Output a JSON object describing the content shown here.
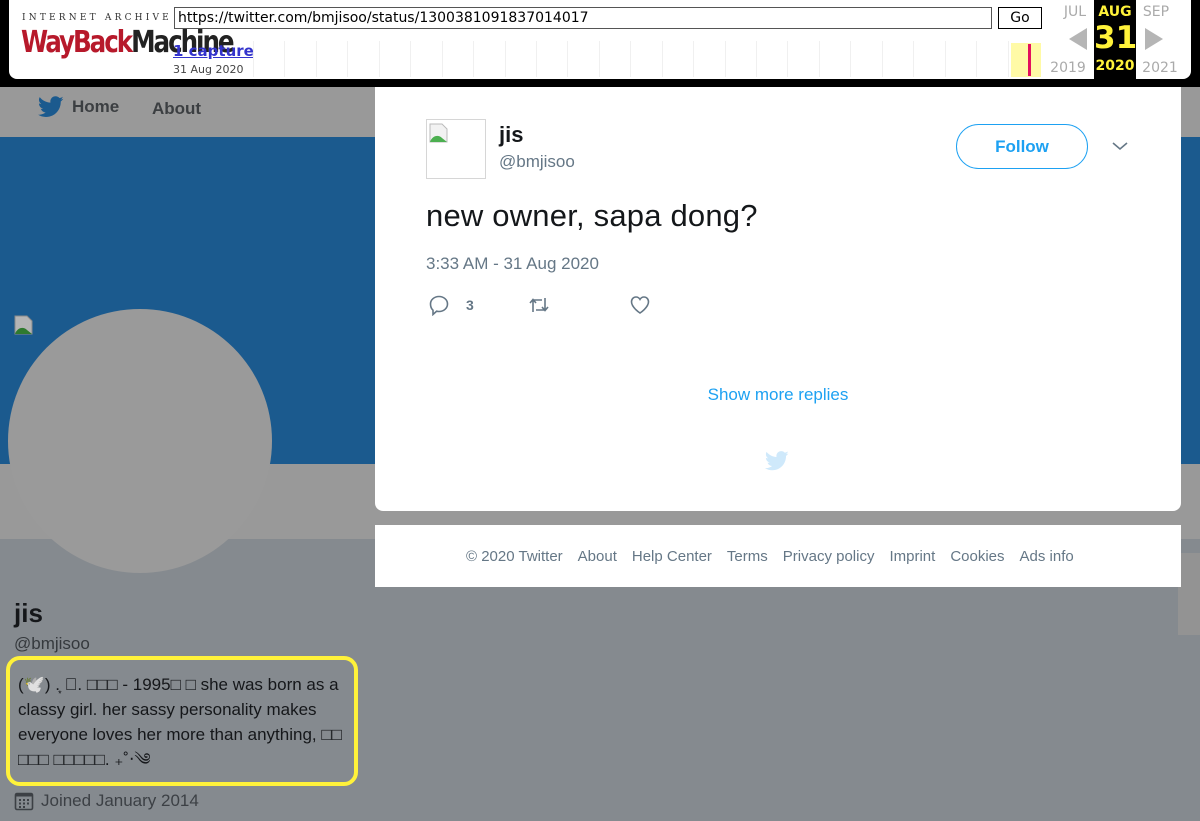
{
  "wayback": {
    "logo_top": "INTERNET ARCHIVE",
    "logo_part1": "WayBack",
    "logo_part2": "Machine",
    "url": "https://twitter.com/bmjisoo/status/1300381091837014017",
    "go_label": "Go",
    "captures_label": "1 capture",
    "captures_date": "31 Aug 2020",
    "prev_month": "JUL",
    "current_month": "AUG",
    "next_month": "SEP",
    "current_day": "31",
    "prev_year": "2019",
    "current_year": "2020",
    "next_year": "2021"
  },
  "nav": {
    "home_label": "Home",
    "about_label": "About"
  },
  "profile": {
    "name": "jis",
    "handle": "@bmjisoo",
    "bio": "(🕊️) .͙ ⃟. □□□ - 1995□ □ she was born as a classy girl. her sassy personality makes everyone loves her more than anything, □□ □□□ □□□□□. ₊˚‧༄",
    "joined": "Joined January 2014"
  },
  "tweet": {
    "author_name": "jis",
    "author_handle": "@bmjisoo",
    "follow_label": "Follow",
    "text": "new owner, sapa dong?",
    "timestamp": "3:33 AM - 31 Aug 2020",
    "reply_count": "3",
    "show_more_label": "Show more replies"
  },
  "footer": {
    "copyright": "© 2020 Twitter",
    "links": [
      "About",
      "Help Center",
      "Terms",
      "Privacy policy",
      "Imprint",
      "Cookies",
      "Ads info"
    ]
  },
  "colors": {
    "twitter_blue": "#1da1f2",
    "wayback_red": "#b7192b",
    "wayback_highlight": "#fff23a",
    "bio_highlight_border": "#fff23a"
  }
}
